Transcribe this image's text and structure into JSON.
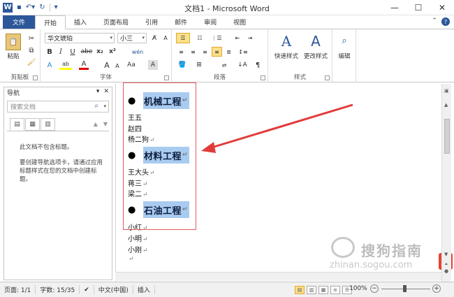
{
  "window": {
    "title": "文档1 - Microsoft Word",
    "app_icon": "W",
    "minimize": "—",
    "maximize": "☐",
    "close": "✕"
  },
  "tabs": [
    {
      "label": "文件",
      "kind": "file"
    },
    {
      "label": "开始",
      "kind": "active"
    },
    {
      "label": "插入",
      "kind": "normal"
    },
    {
      "label": "页面布局",
      "kind": "normal"
    },
    {
      "label": "引用",
      "kind": "normal"
    },
    {
      "label": "邮件",
      "kind": "normal"
    },
    {
      "label": "审阅",
      "kind": "normal"
    },
    {
      "label": "视图",
      "kind": "normal"
    }
  ],
  "ribbon": {
    "clipboard": {
      "paste": "粘贴",
      "label": "剪贴板"
    },
    "font": {
      "font_name": "华文琥珀",
      "font_size": "小三",
      "label": "字体",
      "bold": "B",
      "italic": "I",
      "underline": "U",
      "strike": "abe",
      "sub": "x₂",
      "sup": "x²",
      "grow": "A",
      "shrink": "A",
      "case": "Aa",
      "clear": "A",
      "phonetic": "wén",
      "border": "A",
      "text_effect": "A",
      "highlight": "ab",
      "color": "A"
    },
    "paragraph": {
      "label": "段落"
    },
    "styles": {
      "quick": "快速样式",
      "change": "更改样式",
      "label": "样式"
    },
    "editing": {
      "label": "编辑"
    }
  },
  "nav": {
    "title": "导航",
    "search_placeholder": "搜索文档",
    "msg1": "此文档不包含标题。",
    "msg2": "要创建导航选项卡，请通过应用标题样式在您的文档中创建标题。"
  },
  "document": {
    "headings": [
      "机械工程",
      "材料工程",
      "石油工程"
    ],
    "lines": [
      [
        "王五",
        "赵四",
        "杨二狗"
      ],
      [
        "王大头",
        "蒋三",
        "梁二"
      ],
      [
        "小红",
        "小明",
        "小刚"
      ]
    ],
    "para_mark": "↵"
  },
  "status": {
    "page": "页面: 1/1",
    "words": "字数: 15/35",
    "language": "中文(中国)",
    "mode": "插入",
    "zoom": "100%"
  },
  "watermark": {
    "text": "搜狗指南",
    "url": "zhinan.sogou.com",
    "badge": "S"
  }
}
